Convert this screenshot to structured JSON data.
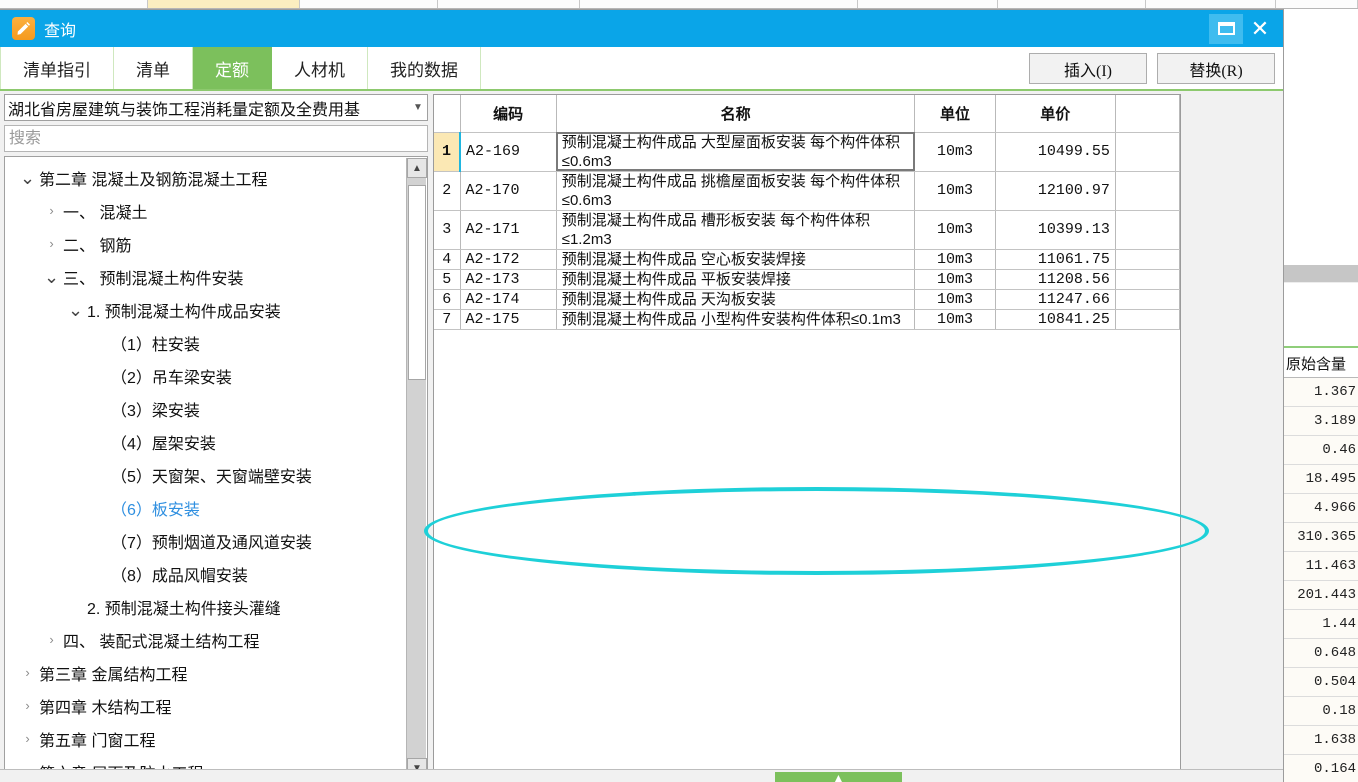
{
  "window": {
    "title": "查询",
    "icon": "edit-pen-icon",
    "restore_label": "restore-icon",
    "close_label": "close-icon",
    "titlebar_color": "#0aa5e8"
  },
  "tabs": [
    {
      "label": "清单指引",
      "active": false
    },
    {
      "label": "清单",
      "active": false
    },
    {
      "label": "定额",
      "active": true
    },
    {
      "label": "人材机",
      "active": false
    },
    {
      "label": "我的数据",
      "active": false
    }
  ],
  "accent": {
    "green": "#7cc05c",
    "blue": "#0aa5e8",
    "highlight_yellow": "#fbeab8",
    "annotation_cyan": "#1ed0d8"
  },
  "actions": {
    "insert_label": "插入(I)",
    "replace_label": "替换(R)"
  },
  "sidebar": {
    "combo_value": "湖北省房屋建筑与装饰工程消耗量定额及全费用基",
    "search_value": "",
    "search_placeholder": "搜索",
    "tree": [
      {
        "label": "第二章 混凝土及钢筋混凝土工程",
        "indent": 0,
        "chev": "down",
        "selected": false
      },
      {
        "label": "一、 混凝土",
        "indent": 1,
        "chev": "right",
        "selected": false
      },
      {
        "label": "二、 钢筋",
        "indent": 1,
        "chev": "right",
        "selected": false
      },
      {
        "label": "三、 预制混凝土构件安装",
        "indent": 1,
        "chev": "down",
        "selected": false
      },
      {
        "label": "1. 预制混凝土构件成品安装",
        "indent": 2,
        "chev": "down",
        "selected": false
      },
      {
        "label": "（1）柱安装",
        "indent": 3,
        "chev": "none",
        "selected": false
      },
      {
        "label": "（2）吊车梁安装",
        "indent": 3,
        "chev": "none",
        "selected": false
      },
      {
        "label": "（3）梁安装",
        "indent": 3,
        "chev": "none",
        "selected": false
      },
      {
        "label": "（4）屋架安装",
        "indent": 3,
        "chev": "none",
        "selected": false
      },
      {
        "label": "（5）天窗架、天窗端壁安装",
        "indent": 3,
        "chev": "none",
        "selected": false
      },
      {
        "label": "（6）板安装",
        "indent": 3,
        "chev": "none",
        "selected": true
      },
      {
        "label": "（7）预制烟道及通风道安装",
        "indent": 3,
        "chev": "none",
        "selected": false
      },
      {
        "label": "（8）成品风帽安装",
        "indent": 3,
        "chev": "none",
        "selected": false
      },
      {
        "label": "2. 预制混凝土构件接头灌缝",
        "indent": 2,
        "chev": "none",
        "selected": false
      },
      {
        "label": "四、 装配式混凝土结构工程",
        "indent": 1,
        "chev": "right",
        "selected": false
      },
      {
        "label": "第三章 金属结构工程",
        "indent": 0,
        "chev": "right",
        "selected": false
      },
      {
        "label": "第四章 木结构工程",
        "indent": 0,
        "chev": "right",
        "selected": false
      },
      {
        "label": "第五章 门窗工程",
        "indent": 0,
        "chev": "right",
        "selected": false
      },
      {
        "label": "第六章 屋面及防水工程",
        "indent": 0,
        "chev": "down",
        "selected": false
      }
    ]
  },
  "table": {
    "headers": {
      "index": "",
      "code": "编码",
      "name": "名称",
      "unit": "单位",
      "price": "单价",
      "extra": ""
    },
    "rows": [
      {
        "index": "1",
        "code": "A2-169",
        "name": "预制混凝土构件成品 大型屋面板安装 每个构件体积≤0.6m3",
        "unit": "10m3",
        "price": "10499.55",
        "selected": true
      },
      {
        "index": "2",
        "code": "A2-170",
        "name": "预制混凝土构件成品 挑檐屋面板安装 每个构件体积≤0.6m3",
        "unit": "10m3",
        "price": "12100.97",
        "selected": false
      },
      {
        "index": "3",
        "code": "A2-171",
        "name": "预制混凝土构件成品 槽形板安装 每个构件体积≤1.2m3",
        "unit": "10m3",
        "price": "10399.13",
        "selected": false
      },
      {
        "index": "4",
        "code": "A2-172",
        "name": "预制混凝土构件成品 空心板安装焊接",
        "unit": "10m3",
        "price": "11061.75",
        "selected": false
      },
      {
        "index": "5",
        "code": "A2-173",
        "name": "预制混凝土构件成品 平板安装焊接",
        "unit": "10m3",
        "price": "11208.56",
        "selected": false
      },
      {
        "index": "6",
        "code": "A2-174",
        "name": "预制混凝土构件成品 天沟板安装",
        "unit": "10m3",
        "price": "11247.66",
        "selected": false
      },
      {
        "index": "7",
        "code": "A2-175",
        "name": "预制混凝土构件成品 小型构件安装构件体积≤0.1m3",
        "unit": "10m3",
        "price": "10841.25",
        "selected": false
      }
    ]
  },
  "annotation": {
    "shape": "ellipse",
    "color": "#1ed0d8",
    "target_row_index": "7"
  },
  "background": {
    "column_header": "原始含量",
    "values": [
      "1.367",
      "3.189",
      "0.46",
      "18.495",
      "4.966",
      "310.365",
      "11.463",
      "201.443",
      "1.44",
      "0.648",
      "0.504",
      "0.18",
      "1.638",
      "0.164"
    ]
  },
  "bottom_bar": {
    "collapse_icon": "chevron-up-icon"
  }
}
